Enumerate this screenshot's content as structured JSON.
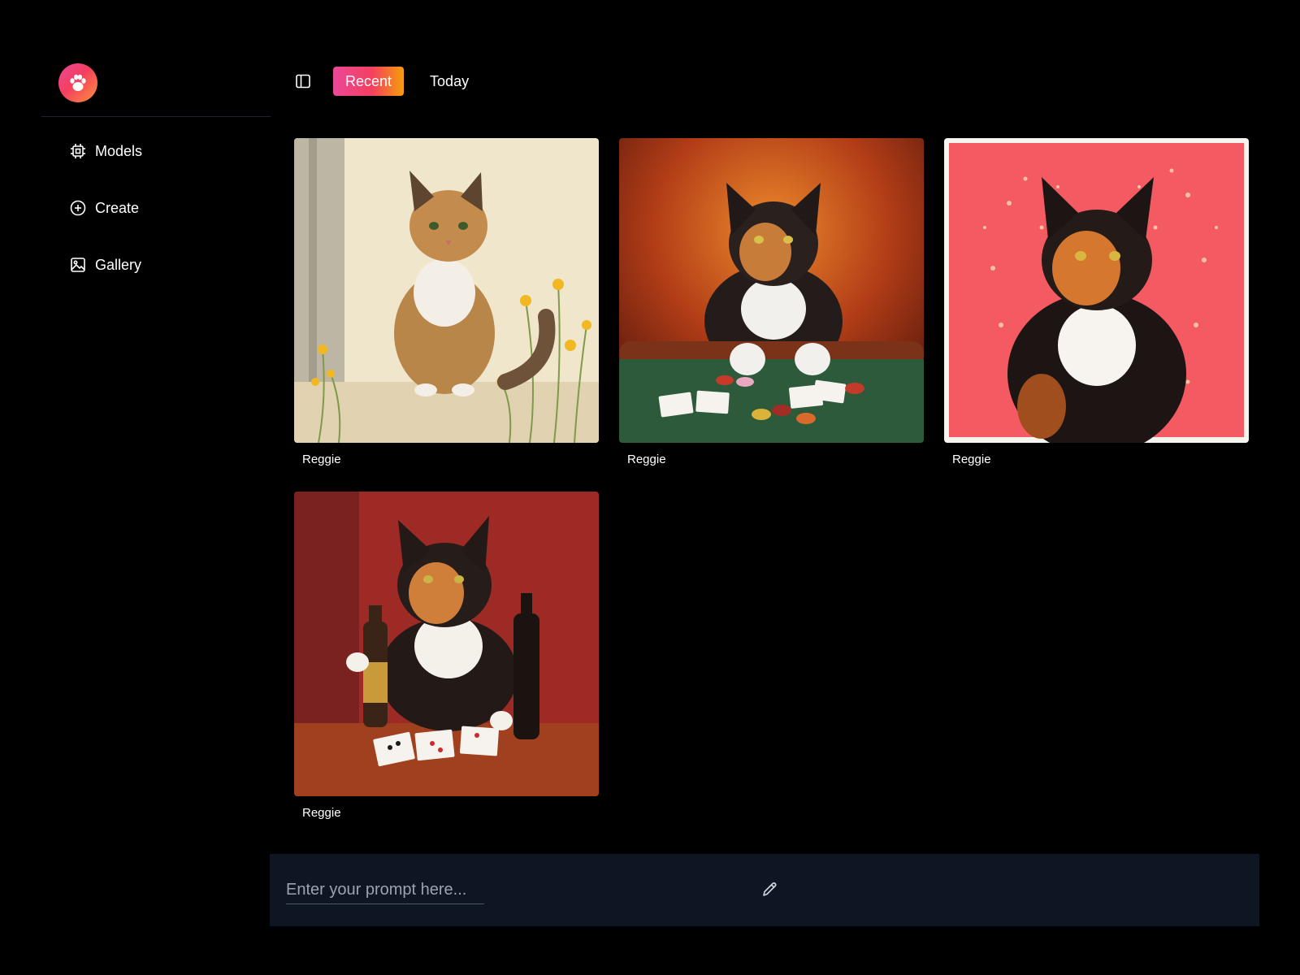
{
  "sidebar": {
    "logo_icon": "paw-icon",
    "items": [
      {
        "label": "Models",
        "icon": "chip-icon"
      },
      {
        "label": "Create",
        "icon": "plus-circle-icon"
      },
      {
        "label": "Gallery",
        "icon": "image-icon"
      }
    ]
  },
  "topbar": {
    "toggle_icon": "sidebar-toggle-icon",
    "tabs": [
      {
        "label": "Recent",
        "active": true
      },
      {
        "label": "Today",
        "active": false
      }
    ]
  },
  "gallery": {
    "cards": [
      {
        "caption": "Reggie",
        "scene": "calico cat sitting among yellow wildflowers"
      },
      {
        "caption": "Reggie",
        "scene": "calico cat at a poker table with cards and chips"
      },
      {
        "caption": "Reggie",
        "scene": "calico cat on red pop-art background"
      },
      {
        "caption": "Reggie",
        "scene": "calico cat with beer bottles and playing cards"
      }
    ]
  },
  "prompt": {
    "placeholder": "Enter your prompt here...",
    "value": "",
    "edit_icon": "pencil-icon"
  },
  "colors": {
    "background": "#000000",
    "accent_gradient_start": "#ec4899",
    "accent_gradient_end": "#f59e0b",
    "prompt_bar": "#0f1623"
  }
}
